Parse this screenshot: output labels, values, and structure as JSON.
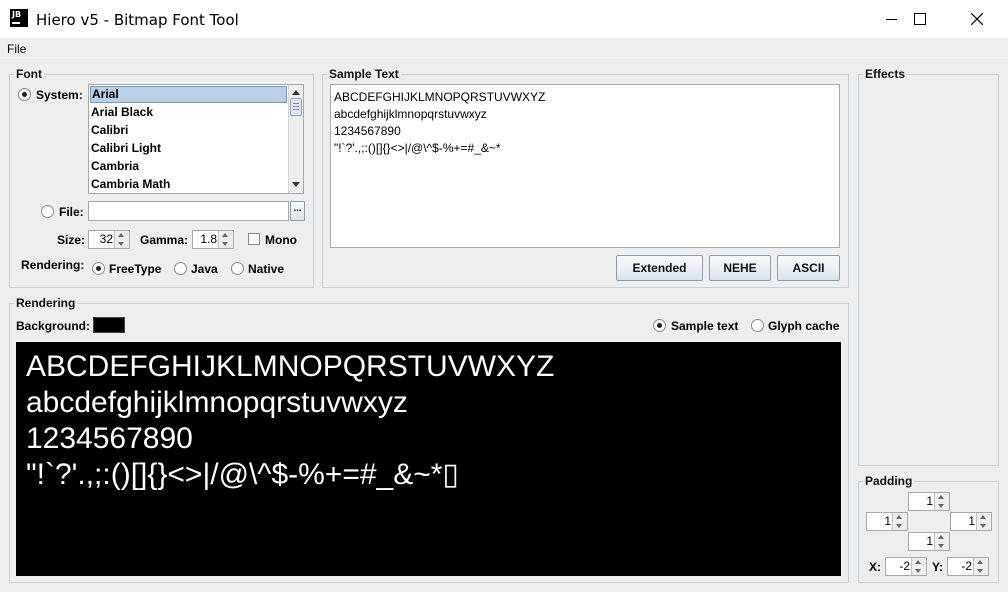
{
  "window": {
    "title": "Hiero v5 - Bitmap Font Tool",
    "logo_text": "JB"
  },
  "menu": {
    "file": "File"
  },
  "font_group": {
    "title": "Font",
    "system_label": "System:",
    "system_selected": true,
    "font_list": [
      "Arial",
      "Arial Black",
      "Calibri",
      "Calibri Light",
      "Cambria",
      "Cambria Math"
    ],
    "selected_font": "Arial",
    "file_label": "File:",
    "file_value": "",
    "browse_label": "...",
    "size_label": "Size:",
    "size_value": "32",
    "gamma_label": "Gamma:",
    "gamma_value": "1.8",
    "mono_label": "Mono",
    "mono_checked": false,
    "rendering_label": "Rendering:",
    "rendering_options": [
      "FreeType",
      "Java",
      "Native"
    ],
    "rendering_selected": "FreeType"
  },
  "sample_text_group": {
    "title": "Sample Text",
    "text": "ABCDEFGHIJKLMNOPQRSTUVWXYZ\nabcdefghijklmnopqrstuvwxyz\n1234567890\n\"!`?'.,;:()[]{}<>|/@\\^$-%+=#_&~*",
    "buttons": [
      "Extended",
      "NEHE",
      "ASCII"
    ]
  },
  "rendering_group": {
    "title": "Rendering",
    "background_label": "Background:",
    "background_color": "#000000",
    "view_options": [
      "Sample text",
      "Glyph cache"
    ],
    "view_selected": "Sample text",
    "preview_text": "ABCDEFGHIJKLMNOPQRSTUVWXYZ\nabcdefghijklmnopqrstuvwxyz\n1234567890\n\"!`?'.,;:()[]{}<>|/@\\^$-%+=#_&~*▯"
  },
  "effects_group": {
    "title": "Effects"
  },
  "padding_group": {
    "title": "Padding",
    "top": "1",
    "left": "1",
    "right": "1",
    "bottom": "1",
    "x_label": "X:",
    "x_value": "-2",
    "y_label": "Y:",
    "y_value": "-2"
  }
}
